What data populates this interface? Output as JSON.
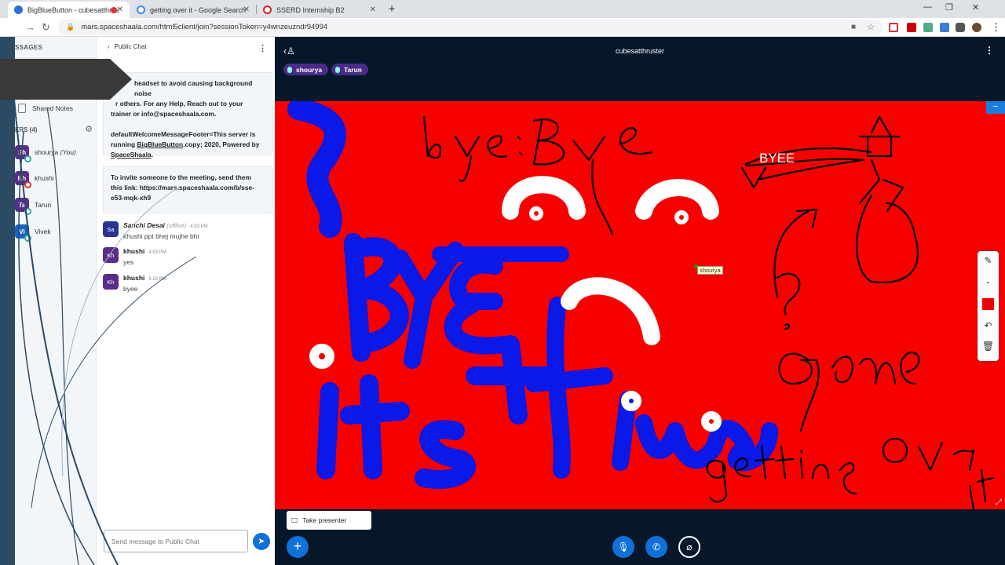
{
  "browser": {
    "tabs": [
      {
        "title": "BigBlueButton - cubesatthrus",
        "color": "#2d6fd6"
      },
      {
        "title": "getting over it - Google Search",
        "color": "#4285f4"
      },
      {
        "title": "SSERD Internship B2",
        "color": "#d22"
      }
    ],
    "new_tab": "+",
    "url": "mars.spaceshaala.com/html5client/join?sessionToken=y4wnzeuzndr94994"
  },
  "users_panel": {
    "messages_header": "SSAGES",
    "shared_notes": "Shared Notes",
    "users_header": "ERS (4)",
    "users": [
      {
        "initials": "Sh",
        "name": "shourya",
        "you": "(You)",
        "color": "#5a2d8a",
        "muted": false
      },
      {
        "initials": "Kh",
        "name": "khushi",
        "you": "",
        "color": "#5a2d8a",
        "muted": true
      },
      {
        "initials": "Ta",
        "name": "Tarun",
        "you": "",
        "color": "#5a2d8a",
        "muted": false
      },
      {
        "initials": "Vi",
        "name": "Vivek",
        "you": "",
        "color": "#1565c0",
        "muted": false
      }
    ]
  },
  "chat": {
    "title": "Public Chat",
    "welcome_lines": [
      "headset to avoid causing background noise",
      "r others. For any Help, Reach out to your",
      "trainer or info@spaceshaala.com."
    ],
    "footer_line1": "defaultWelcomeMessageFooter=This server is",
    "footer_line2_pre": "running ",
    "footer_link": "BigBlueButton",
    "footer_line2_post": ".copy; 2020, Powered by",
    "footer_link2": "SpaceShaala",
    "footer_end": ".",
    "invite_text": "To invite someone to the meeting, send them this link: https://mars.spaceshaala.com/b/sse-e53-mqk-xh9",
    "messages": [
      {
        "initials": "Sa",
        "name": "Sanchi Desai",
        "status": "(offline)",
        "time": "4:53 PM",
        "text": "khushi ppt bhej mujhe bhi",
        "color": "#283593"
      },
      {
        "initials": "Kh",
        "name": "khushi",
        "status": "",
        "time": "4:53 PM",
        "text": "yes",
        "color": "#5a2d8a"
      },
      {
        "initials": "Kh",
        "name": "khushi",
        "status": "",
        "time": "5:20 PM",
        "text": "byee",
        "color": "#5a2d8a"
      }
    ],
    "input_placeholder": "Send message to Public Chat"
  },
  "main": {
    "meeting_title": "cubesatthruster",
    "talkers": [
      {
        "name": "shourya",
        "color": "#4a2c87"
      },
      {
        "name": "Tarun",
        "color": "#4a2c87"
      }
    ],
    "cursor_label": "shourya",
    "take_presenter": "Take presenter",
    "whiteboard_texts": {
      "byee": "BYEE"
    },
    "colors": {
      "whiteboard": "#f70000",
      "accent": "#0f70d7",
      "ink_blue": "#0a18e8"
    }
  }
}
